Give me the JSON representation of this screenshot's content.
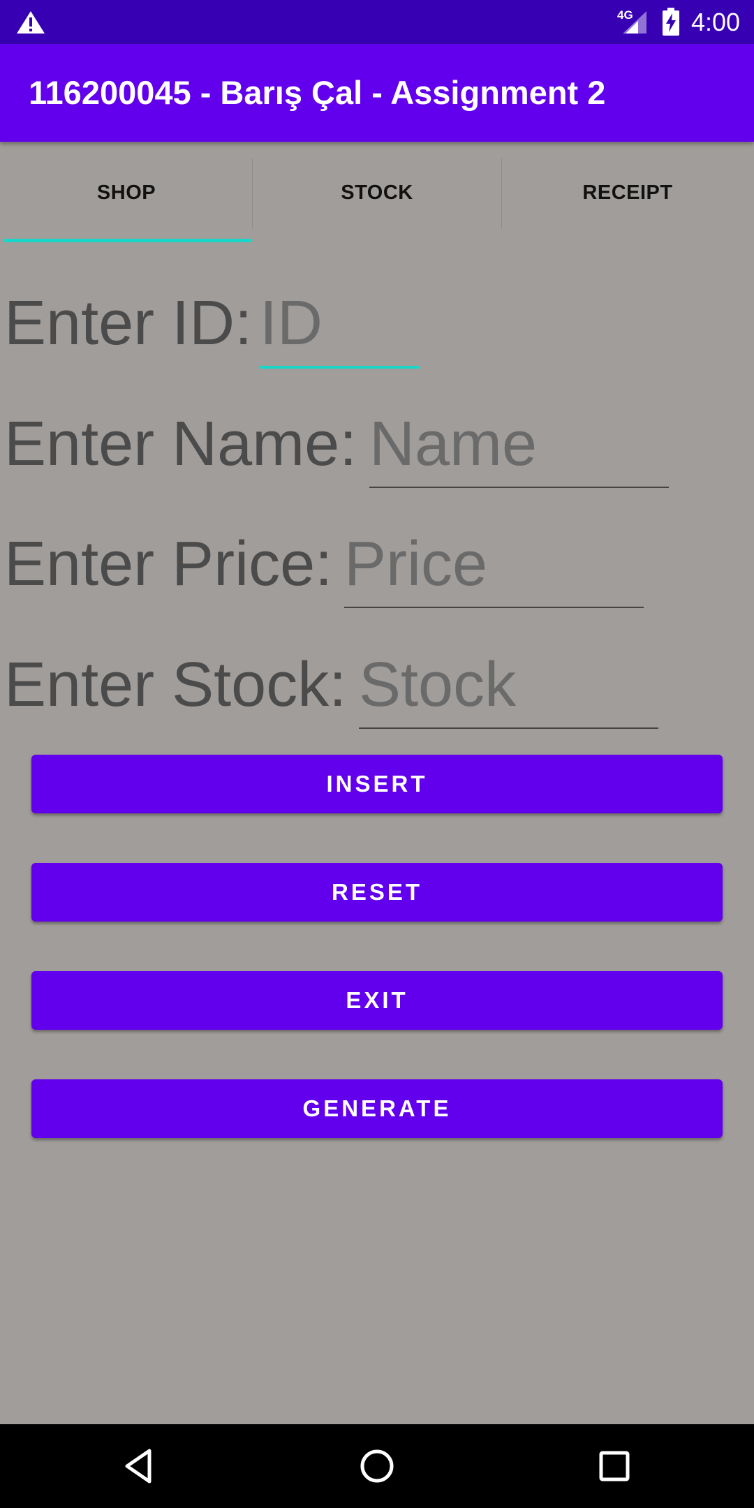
{
  "status_bar": {
    "network": "4G",
    "time": "4:00",
    "icons": [
      "warning-icon",
      "signal-icon",
      "battery-charging-icon"
    ]
  },
  "app_bar": {
    "title": "116200045 - Barış Çal - Assignment 2"
  },
  "tabs": [
    {
      "label": "SHOP",
      "selected": true
    },
    {
      "label": "STOCK",
      "selected": false
    },
    {
      "label": "RECEIPT",
      "selected": false
    }
  ],
  "form": {
    "id": {
      "label": "Enter ID:",
      "placeholder": "ID",
      "value": ""
    },
    "name": {
      "label": "Enter Name:",
      "placeholder": "Name",
      "value": ""
    },
    "price": {
      "label": "Enter Price:",
      "placeholder": "Price",
      "value": ""
    },
    "stock": {
      "label": "Enter Stock:",
      "placeholder": "Stock",
      "value": ""
    }
  },
  "buttons": {
    "insert": "INSERT",
    "reset": "RESET",
    "exit": "EXIT",
    "generate": "GENERATE"
  },
  "nav_bar": {
    "icons": [
      "back-icon",
      "home-icon",
      "recents-icon"
    ]
  },
  "colors": {
    "status_bar": "#3700b3",
    "primary": "#6200ee",
    "accent": "#18d6c8",
    "background": "#a19d9a"
  }
}
